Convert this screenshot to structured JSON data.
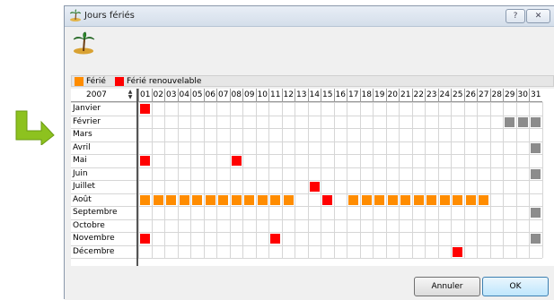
{
  "window": {
    "title": "Jours fériés"
  },
  "titlebar_buttons": {
    "help": "?",
    "close": "✕"
  },
  "legend": {
    "holiday_label": "Férié",
    "holiday_color": "#ff8c00",
    "renewable_label": "Férié renouvelable",
    "renewable_color": "#ff0000"
  },
  "year": "2007",
  "days": [
    "01",
    "02",
    "03",
    "04",
    "05",
    "06",
    "07",
    "08",
    "09",
    "10",
    "11",
    "12",
    "13",
    "14",
    "15",
    "16",
    "17",
    "18",
    "19",
    "20",
    "21",
    "22",
    "23",
    "24",
    "25",
    "26",
    "27",
    "28",
    "29",
    "30",
    "31"
  ],
  "months": [
    "Janvier",
    "Février",
    "Mars",
    "Avril",
    "Mai",
    "Juin",
    "Juillet",
    "Août",
    "Septembre",
    "Octobre",
    "Novembre",
    "Décembre"
  ],
  "colors": {
    "invalid_day": "#8c8c8c"
  },
  "holidays": [
    {
      "month": "Janvier",
      "day": 1,
      "type": "renewable"
    },
    {
      "month": "Mai",
      "day": 1,
      "type": "renewable"
    },
    {
      "month": "Mai",
      "day": 8,
      "type": "renewable"
    },
    {
      "month": "Juillet",
      "day": 14,
      "type": "renewable"
    },
    {
      "month": "Août",
      "day": 15,
      "type": "renewable"
    },
    {
      "month": "Novembre",
      "day": 1,
      "type": "renewable"
    },
    {
      "month": "Novembre",
      "day": 11,
      "type": "renewable"
    },
    {
      "month": "Décembre",
      "day": 25,
      "type": "renewable"
    },
    {
      "month": "Août",
      "day": 1,
      "type": "holiday"
    },
    {
      "month": "Août",
      "day": 2,
      "type": "holiday"
    },
    {
      "month": "Août",
      "day": 3,
      "type": "holiday"
    },
    {
      "month": "Août",
      "day": 4,
      "type": "holiday"
    },
    {
      "month": "Août",
      "day": 5,
      "type": "holiday"
    },
    {
      "month": "Août",
      "day": 6,
      "type": "holiday"
    },
    {
      "month": "Août",
      "day": 7,
      "type": "holiday"
    },
    {
      "month": "Août",
      "day": 8,
      "type": "holiday"
    },
    {
      "month": "Août",
      "day": 9,
      "type": "holiday"
    },
    {
      "month": "Août",
      "day": 10,
      "type": "holiday"
    },
    {
      "month": "Août",
      "day": 11,
      "type": "holiday"
    },
    {
      "month": "Août",
      "day": 12,
      "type": "holiday"
    },
    {
      "month": "Août",
      "day": 17,
      "type": "holiday"
    },
    {
      "month": "Août",
      "day": 18,
      "type": "holiday"
    },
    {
      "month": "Août",
      "day": 19,
      "type": "holiday"
    },
    {
      "month": "Août",
      "day": 20,
      "type": "holiday"
    },
    {
      "month": "Août",
      "day": 21,
      "type": "holiday"
    },
    {
      "month": "Août",
      "day": 22,
      "type": "holiday"
    },
    {
      "month": "Août",
      "day": 23,
      "type": "holiday"
    },
    {
      "month": "Août",
      "day": 24,
      "type": "holiday"
    },
    {
      "month": "Août",
      "day": 25,
      "type": "holiday"
    },
    {
      "month": "Août",
      "day": 26,
      "type": "holiday"
    },
    {
      "month": "Août",
      "day": 27,
      "type": "holiday"
    }
  ],
  "invalid_days": [
    {
      "month": "Février",
      "day": 29
    },
    {
      "month": "Février",
      "day": 30
    },
    {
      "month": "Février",
      "day": 31
    },
    {
      "month": "Avril",
      "day": 31
    },
    {
      "month": "Juin",
      "day": 31
    },
    {
      "month": "Septembre",
      "day": 31
    },
    {
      "month": "Novembre",
      "day": 31
    }
  ],
  "buttons": {
    "cancel": "Annuler",
    "ok": "OK"
  }
}
